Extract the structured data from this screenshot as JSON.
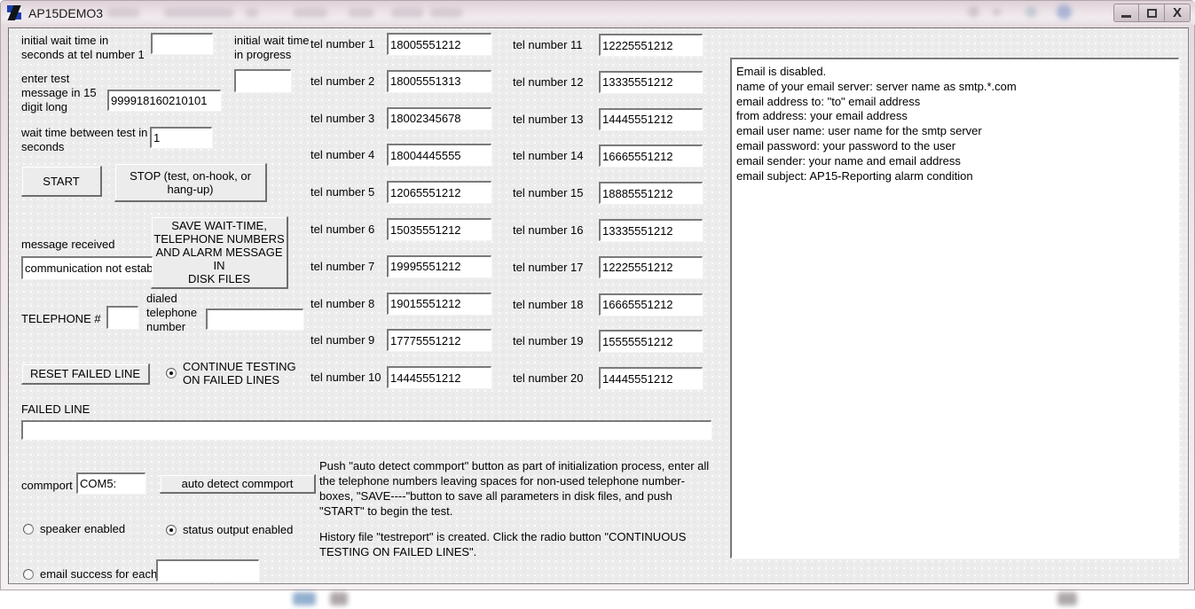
{
  "window": {
    "title": "AP15DEMO3",
    "icon": "app-icon",
    "controls": {
      "minimize": "Minimize",
      "maximize": "Maximize",
      "close": "X"
    }
  },
  "form": {
    "initial_wait": {
      "label": "initial wait time in\nseconds at tel number 1",
      "value": ""
    },
    "initial_wait_progress": {
      "label": "initial wait time\nin progress",
      "value": ""
    },
    "test_message": {
      "label": "enter test\nmessage in 15\ndigit long",
      "value": "999918160210101"
    },
    "wait_between": {
      "label": "wait time between test in\nseconds",
      "value": "1"
    },
    "start_button": "START",
    "stop_button": "STOP (test, on-hook, or\nhang-up)",
    "save_button": "SAVE WAIT-TIME,\nTELEPHONE NUMBERS\nAND ALARM MESSAGE IN\nDISK FILES",
    "message_received": {
      "label": "message received",
      "value": "communication not establi"
    },
    "telephone_number": {
      "label": "TELEPHONE #",
      "value": ""
    },
    "dialed_number": {
      "label": "dialed\ntelephone\nnumber",
      "value": ""
    },
    "reset_failed_line_button": "RESET FAILED LINE",
    "continue_testing_radio": {
      "label": "CONTINUE TESTING\nON FAILED LINES",
      "selected": true
    },
    "failed_line": {
      "label": "FAILED LINE",
      "value": ""
    },
    "commport": {
      "label": "commport",
      "value": "COM5:"
    },
    "auto_detect_button": "auto detect commport",
    "speaker_radio": {
      "label": "speaker enabled",
      "selected": false
    },
    "status_output_radio": {
      "label": "status output enabled",
      "selected": true
    },
    "email_success_radio": {
      "label": "email success for each:",
      "selected": false,
      "value": ""
    }
  },
  "tel_numbers": [
    {
      "label": "tel number 1",
      "value": "18005551212"
    },
    {
      "label": "tel number 2",
      "value": "18005551313"
    },
    {
      "label": "tel number 3",
      "value": "18002345678"
    },
    {
      "label": "tel number 4",
      "value": "18004445555"
    },
    {
      "label": "tel number 5",
      "value": "12065551212"
    },
    {
      "label": "tel number 6",
      "value": "15035551212"
    },
    {
      "label": "tel number 7",
      "value": "19995551212"
    },
    {
      "label": "tel number 8",
      "value": "19015551212"
    },
    {
      "label": "tel number 9",
      "value": "17775551212"
    },
    {
      "label": "tel number 10",
      "value": "14445551212"
    },
    {
      "label": "tel number 11",
      "value": "12225551212"
    },
    {
      "label": "tel number 12",
      "value": "13335551212"
    },
    {
      "label": "tel number 13",
      "value": "14445551212"
    },
    {
      "label": "tel number 14",
      "value": "16665551212"
    },
    {
      "label": "tel number 15",
      "value": "18885551212"
    },
    {
      "label": "tel number 16",
      "value": "13335551212"
    },
    {
      "label": "tel number 17",
      "value": "12225551212"
    },
    {
      "label": "tel number 18",
      "value": "16665551212"
    },
    {
      "label": "tel number 19",
      "value": "15555551212"
    },
    {
      "label": "tel number 20",
      "value": "14445551212"
    }
  ],
  "email_panel": {
    "lines": [
      "Email is disabled.",
      "name of your email server: server name as smtp.*.com",
      "email address to: \"to\" email address",
      "from address: your email address",
      "email user name: user name for the smtp server",
      "email password: your password to the user",
      "email sender: your name and email address",
      "email subject: AP15-Reporting alarm condition"
    ]
  },
  "instructions": {
    "paragraph1": "Push \"auto detect commport\" button as part of initialization process, enter all the telephone numbers leaving spaces for non-used telephone number-boxes, \"SAVE----\"button to save all parameters in disk files, and push \"START\" to begin the test.",
    "paragraph2": " History file \"testreport\" is created. Click the radio button \"CONTINUOUS TESTING ON FAILED LINES\"."
  },
  "colors": {
    "client_background": "#ececec",
    "titlebar": "#e9dfe4",
    "text": "#000000",
    "field_background": "#ffffff",
    "border": "#7a7a7a"
  }
}
